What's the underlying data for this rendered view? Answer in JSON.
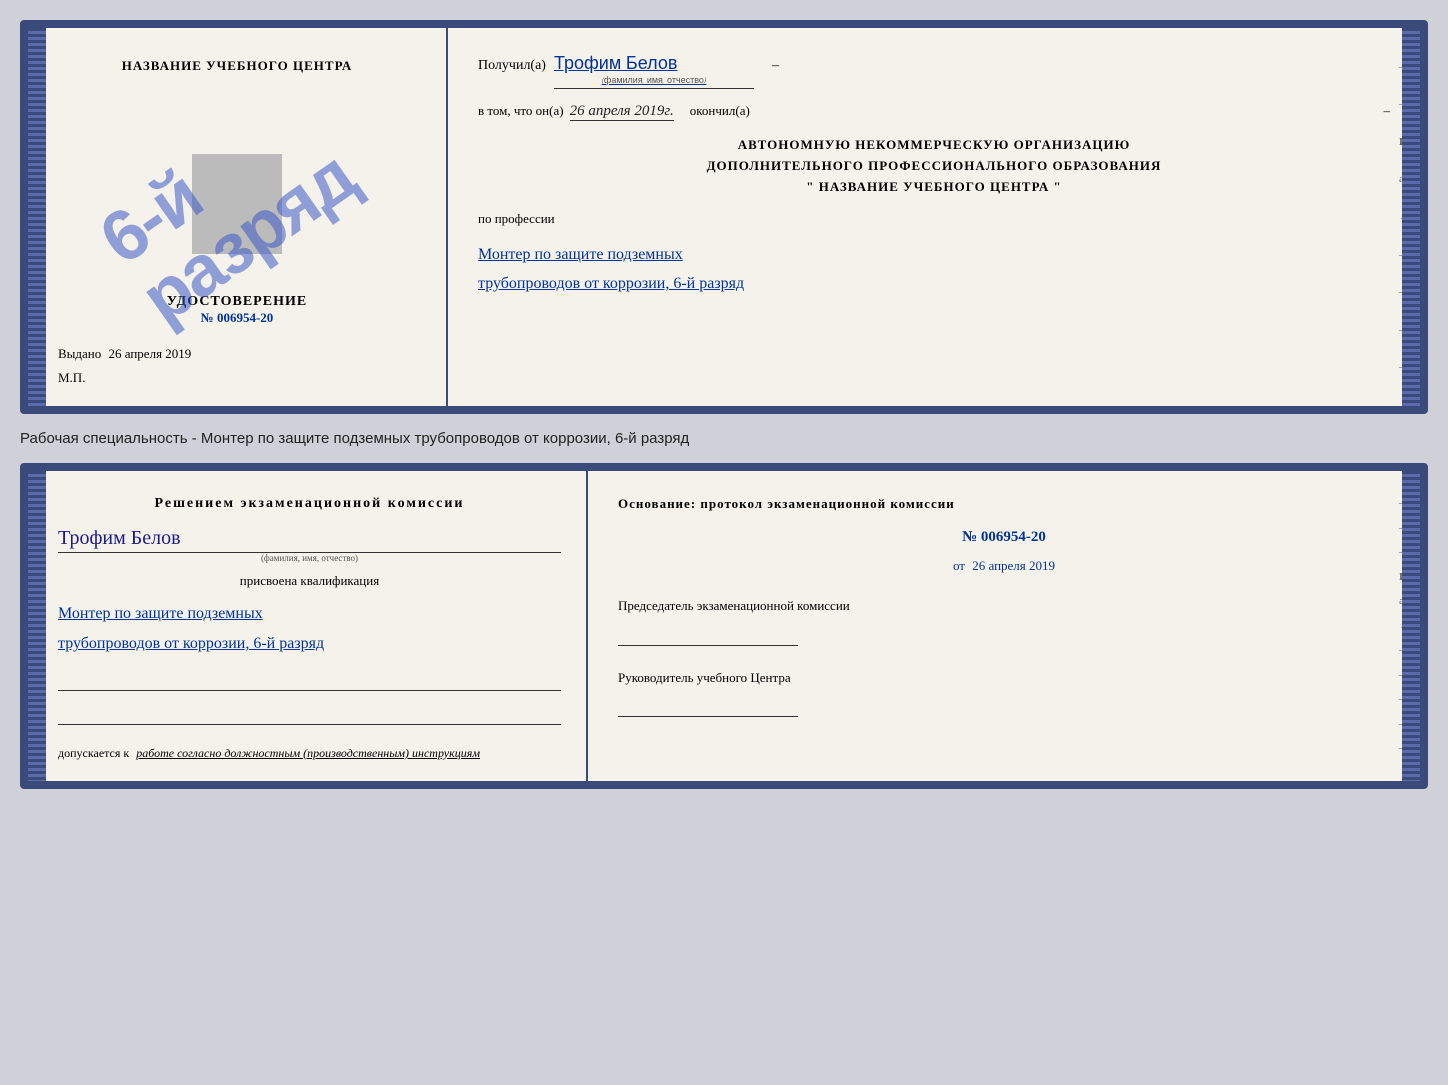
{
  "top_doc": {
    "left": {
      "title": "НАЗВАНИЕ УЧЕБНОГО ЦЕНТРА",
      "udostoverenie_label": "УДОСТОВЕРЕНИЕ",
      "udostoverenie_num": "№ 006954-20",
      "vydano_label": "Выдано",
      "vydano_date": "26 апреля 2019",
      "mp_label": "М.П."
    },
    "stamp": "6-й разряд",
    "right": {
      "poluchil_prefix": "Получил(а)",
      "poluchil_name": "Трофим Белов",
      "poluchil_sublabel": "(фамилия, имя, отчество)",
      "dash1": "–",
      "vtom_label": "в том, что он(а)",
      "vtom_date": "26 апреля 2019г.",
      "vtom_underline": true,
      "okoncil_label": "окончил(а)",
      "dash2": "–",
      "org_line1": "АВТОНОМНУЮ НЕКОММЕРЧЕСКУЮ ОРГАНИЗАЦИЮ",
      "org_line2": "ДОПОЛНИТЕЛЬНОГО ПРОФЕССИОНАЛЬНОГО ОБРАЗОВАНИЯ",
      "org_line3": "\"   НАЗВАНИЕ УЧЕБНОГО ЦЕНТРА   \"",
      "dash3": "–",
      "i_label": "И",
      "a_label": "а",
      "arrow_label": "←",
      "po_professii": "по профессии",
      "profession_line1": "Монтер по защите подземных",
      "profession_line2": "трубопроводов от коррозии, 6-й разряд",
      "dash4": "–"
    }
  },
  "caption": {
    "text": "Рабочая специальность - Монтер по защите подземных трубопроводов от коррозии, 6-й разряд"
  },
  "bottom_doc": {
    "left": {
      "resheniem_title": "Решением  экзаменационной  комиссии",
      "name": "Трофим Белов",
      "name_sublabel": "(фамилия, имя, отчество)",
      "prisvoena": "присвоена квалификация",
      "qualification_line1": "Монтер по защите подземных",
      "qualification_line2": "трубопроводов от коррозии, 6-й разряд",
      "dopuskaetsya_prefix": "допускается к",
      "dopuskaetsya_text": "работе согласно должностным (производственным) инструкциям"
    },
    "right": {
      "osnovanie": "Основание: протокол экзаменационной  комиссии",
      "protocol_num": "№  006954-20",
      "ot_prefix": "от",
      "ot_date": "26 апреля 2019",
      "predsedatel_title": "Председатель экзаменационной комиссии",
      "rukovoditel_title": "Руководитель учебного Центра",
      "dashes": [
        "-",
        "-",
        "-",
        "И",
        "а",
        "←",
        "-",
        "-",
        "-",
        "-",
        "-"
      ]
    }
  }
}
